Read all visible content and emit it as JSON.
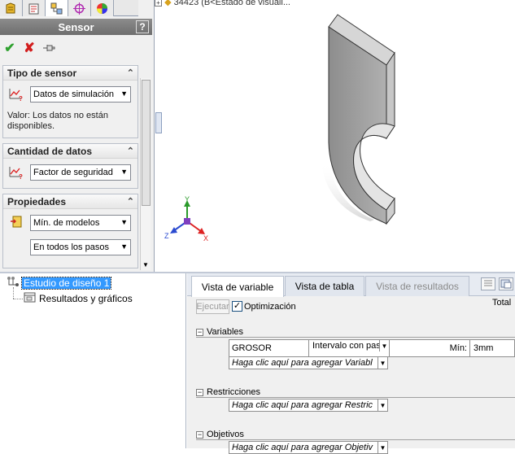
{
  "colors": {
    "accent_selection": "#3399ff",
    "title_bar": "#7a7a7a",
    "ok": "#2ea12e",
    "cancel": "#d21d1d"
  },
  "feature_tabs": [
    "feature-manager-icon",
    "property-manager-icon",
    "configuration-manager-icon",
    "dimxpert-icon",
    "display-manager-icon"
  ],
  "graphics": {
    "tree_top_text": "34423  (B<Estado de visuali..."
  },
  "property_manager": {
    "title": "Sensor",
    "help": "?",
    "groups": {
      "sensor_type": {
        "title": "Tipo de sensor",
        "dropdown": "Datos de simulación",
        "value_text": "Valor: Los datos no están disponibles."
      },
      "data_quantity": {
        "title": "Cantidad de datos",
        "dropdown": "Factor de seguridad"
      },
      "properties": {
        "title": "Propiedades",
        "dropdown1": "Mín. de modelos",
        "dropdown2": "En todos los pasos"
      }
    }
  },
  "study_tree": {
    "root": "Estudio de diseño 1",
    "child": "Resultados y gráficos"
  },
  "study": {
    "tabs": [
      "Vista de variable",
      "Vista de tabla",
      "Vista de resultados"
    ],
    "run_label": "Ejecutar",
    "optimization_label": "Optimización",
    "optimization_checked": "✓",
    "total_label": "Total",
    "variables": {
      "title": "Variables",
      "row": {
        "name": "GROSOR",
        "type": "Intervalo con paso",
        "min_label": "Mín:",
        "min_value": "3mm"
      },
      "add_hint": "Haga clic aquí para agregar Variabl"
    },
    "constraints": {
      "title": "Restricciones",
      "add_hint": "Haga clic aquí para agregar Restric"
    },
    "goals": {
      "title": "Objetivos",
      "add_hint": "Haga clic aquí para agregar Objetiv"
    }
  }
}
